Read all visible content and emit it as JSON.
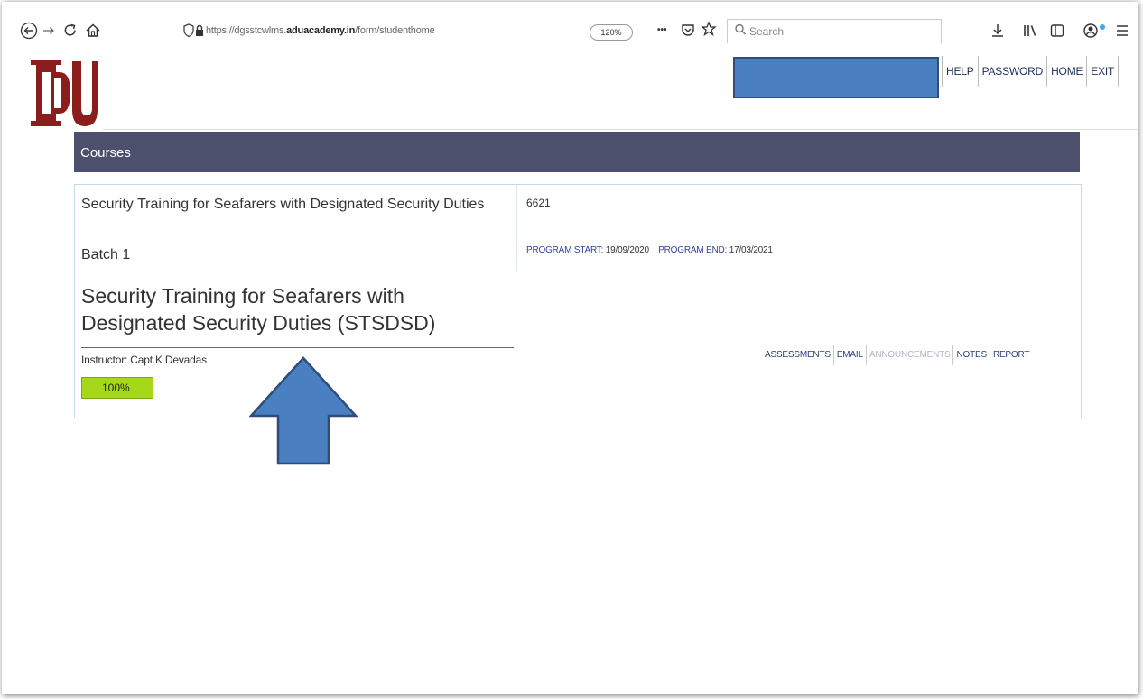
{
  "browser": {
    "url_prefix": "https://dgsstcwlms.",
    "url_domain": "aduacademy.in",
    "url_path": "/form/studenthome",
    "zoom": "120%",
    "search_placeholder": "Search",
    "more_label": "•••"
  },
  "header": {
    "nav": [
      "HELP",
      "PASSWORD",
      "HOME",
      "EXIT"
    ],
    "logo_color": "#8b1d1d"
  },
  "courses": {
    "heading": "Courses",
    "course": {
      "title": "Security Training for Seafarers with Designated Security Duties",
      "batch": "Batch 1",
      "code": "6621",
      "start_label": "PROGRAM START:",
      "start_date": "19/09/2020",
      "end_label": "PROGRAM END:",
      "end_date": "17/03/2021",
      "full_title": "Security Training for Seafarers with Designated Security Duties (STSDSD)",
      "instructor": "Instructor: Capt.K Devadas",
      "progress": "100%",
      "progress_fraction": 1.0,
      "actions": [
        {
          "label": "ASSESSMENTS",
          "enabled": true
        },
        {
          "label": "EMAIL",
          "enabled": true
        },
        {
          "label": "ANNOUNCEMENTS",
          "enabled": false
        },
        {
          "label": "NOTES",
          "enabled": true
        },
        {
          "label": "REPORT",
          "enabled": true
        }
      ]
    }
  },
  "colors": {
    "header_bar": "#4c506c",
    "progress": "#a5d81a",
    "redaction": "#4a7fc1",
    "annotation_arrow": "#4a7fc1"
  }
}
